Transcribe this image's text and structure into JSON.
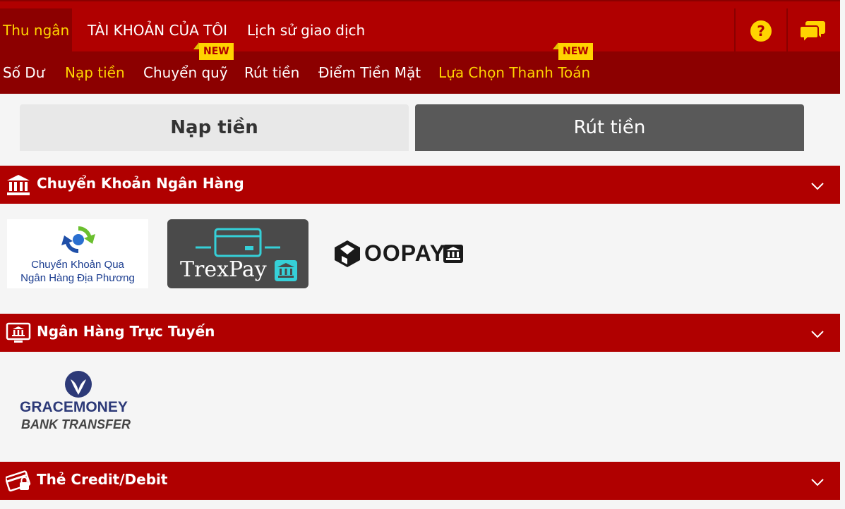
{
  "top_tabs": [
    {
      "label": "Thu ngân",
      "active": true
    },
    {
      "label": "TÀI KHOẢN CỦA TÔI",
      "active": false
    },
    {
      "label": "Lịch sử giao dịch",
      "active": false
    }
  ],
  "top_icons": [
    "help-icon",
    "chat-icon"
  ],
  "sub_tabs": [
    {
      "label": "Số Dư",
      "highlight": false
    },
    {
      "label": "Nạp tiền",
      "highlight": true
    },
    {
      "label": "Chuyển quỹ",
      "highlight": false,
      "badge": "NEW"
    },
    {
      "label": "Rút tiền",
      "highlight": false
    },
    {
      "label": "Điểm Tiền Mặt",
      "highlight": false
    },
    {
      "label": "Lựa Chọn Thanh Toán",
      "highlight": true,
      "badge": "NEW"
    }
  ],
  "toggle": {
    "deposit": "Nạp tiền",
    "withdraw": "Rút tiền",
    "selected": "withdraw"
  },
  "sections": [
    {
      "title": "Chuyển Khoản Ngân Hàng",
      "icon": "bank-icon"
    },
    {
      "title": "Ngân Hàng Trực Tuyến",
      "icon": "online-bank-icon"
    },
    {
      "title": "Thẻ Credit/Debit",
      "icon": "credit-card-icon"
    }
  ],
  "logos": {
    "local": {
      "line1": "Chuyển Khoản Qua",
      "line2": "Ngân Hàng Địa Phương"
    },
    "trexpay": {
      "text": "TrexPay"
    },
    "oopay": {
      "text": "OOPAY"
    },
    "grace": {
      "line1": "GRACEMONEY",
      "line2": "BANK TRANSFER"
    }
  },
  "colors": {
    "primary_red": "#b00000",
    "dark_red": "#8c0000",
    "accent_yellow": "#ffd400",
    "toggle_dark": "#595959",
    "toggle_light": "#e8e8e8"
  }
}
